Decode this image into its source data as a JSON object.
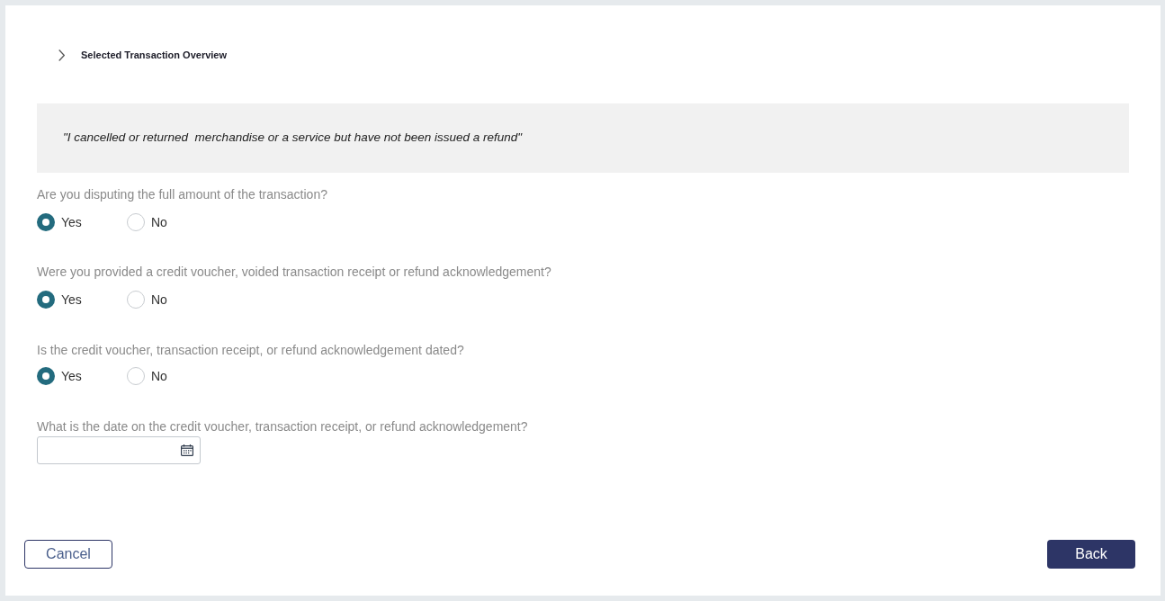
{
  "section": {
    "title": "Selected Transaction Overview",
    "expanded": false
  },
  "reason": {
    "quote": "\"I cancelled or returned  merchandise or a service but have not been issued a refund\""
  },
  "questions": [
    {
      "kind": "radio",
      "label": "Are you disputing the full amount of the transaction?",
      "options": [
        {
          "label": "Yes",
          "selected": true
        },
        {
          "label": "No",
          "selected": false
        }
      ]
    },
    {
      "kind": "radio",
      "label": "Were you provided a credit voucher, voided transaction receipt or refund acknowledgement?",
      "options": [
        {
          "label": "Yes",
          "selected": true
        },
        {
          "label": "No",
          "selected": false
        }
      ]
    },
    {
      "kind": "radio",
      "label": "Is the credit voucher, transaction receipt, or refund acknowledgement dated?",
      "options": [
        {
          "label": "Yes",
          "selected": true
        },
        {
          "label": "No",
          "selected": false
        }
      ]
    },
    {
      "kind": "date",
      "label": "What is the date on the credit voucher, transaction receipt, or refund acknowledgement?"
    }
  ],
  "buttons": [
    {
      "label": "Cancel",
      "kind": "secondary"
    },
    {
      "label": "Back",
      "kind": "primary"
    }
  ]
}
